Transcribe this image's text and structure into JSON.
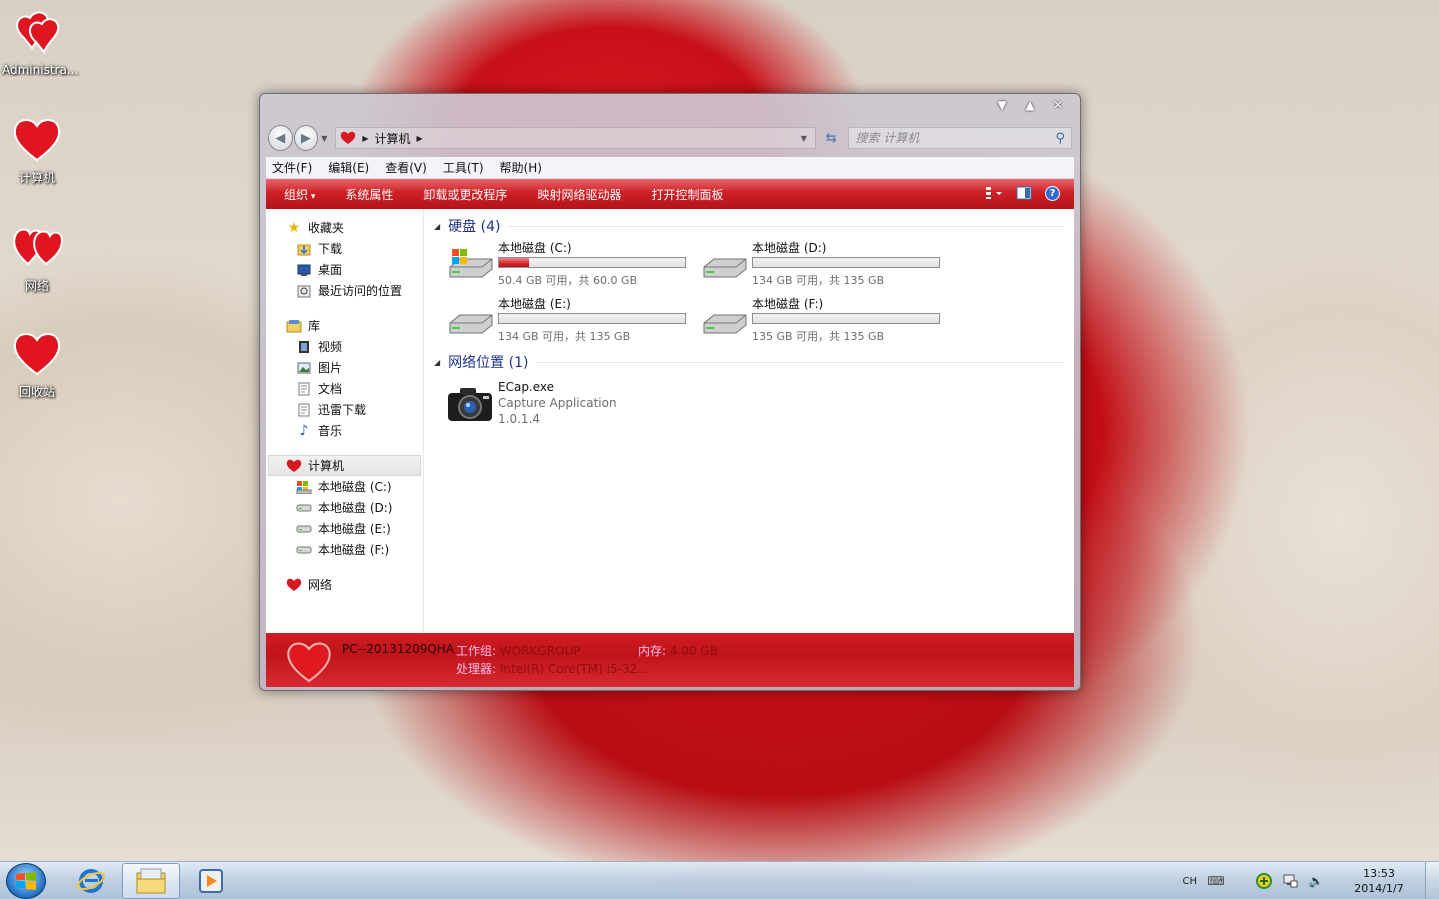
{
  "desktop": {
    "icons": [
      {
        "label": "Administra...",
        "icon": "heart-icon"
      },
      {
        "label": "计算机",
        "icon": "heart-icon"
      },
      {
        "label": "网络",
        "icon": "heart-icon"
      },
      {
        "label": "回收站",
        "icon": "heart-icon"
      }
    ]
  },
  "window": {
    "address": {
      "root": "计算机"
    },
    "search": {
      "placeholder": "搜索 计算机"
    },
    "menu": [
      "文件(F)",
      "编辑(E)",
      "查看(V)",
      "工具(T)",
      "帮助(H)"
    ],
    "toolbar": [
      "组织",
      "系统属性",
      "卸载或更改程序",
      "映射网络驱动器",
      "打开控制面板"
    ],
    "nav": {
      "favorites": {
        "label": "收藏夹",
        "items": [
          "下载",
          "桌面",
          "最近访问的位置"
        ]
      },
      "libraries": {
        "label": "库",
        "items": [
          "视频",
          "图片",
          "文档",
          "迅雷下载",
          "音乐"
        ]
      },
      "computer": {
        "label": "计算机",
        "items": [
          "本地磁盘 (C:)",
          "本地磁盘 (D:)",
          "本地磁盘 (E:)",
          "本地磁盘 (F:)"
        ]
      },
      "network": {
        "label": "网络"
      }
    },
    "groups": {
      "drives_header": "硬盘 (4)",
      "network_header": "网络位置 (1)"
    },
    "drives": [
      {
        "name": "本地磁盘 (C:)",
        "free": "50.4 GB 可用，共 60.0 GB",
        "used_fraction": 0.16,
        "system": true
      },
      {
        "name": "本地磁盘 (D:)",
        "free": "134 GB 可用，共 135 GB",
        "used_fraction": 0.0,
        "system": false
      },
      {
        "name": "本地磁盘 (E:)",
        "free": "134 GB 可用，共 135 GB",
        "used_fraction": 0.0,
        "system": false
      },
      {
        "name": "本地磁盘 (F:)",
        "free": "135 GB 可用，共 135 GB",
        "used_fraction": 0.0,
        "system": false
      }
    ],
    "network_item": {
      "name": "ECap.exe",
      "desc": "Capture Application",
      "version": "1.0.1.4"
    },
    "details": {
      "pc_name": "PC--20131209QHA",
      "workgroup_label": "工作组:",
      "workgroup_value": "WORKGROUP",
      "memory_label": "内存:",
      "memory_value": "4.00 GB",
      "cpu_label": "处理器:",
      "cpu_value": "Intel(R) Core(TM) i5-32..."
    }
  },
  "taskbar": {
    "lang": "CH",
    "time": "13:53",
    "date": "2014/1/7"
  },
  "colors": {
    "accent_red": "#cf2027",
    "group_header": "#1e3287"
  }
}
